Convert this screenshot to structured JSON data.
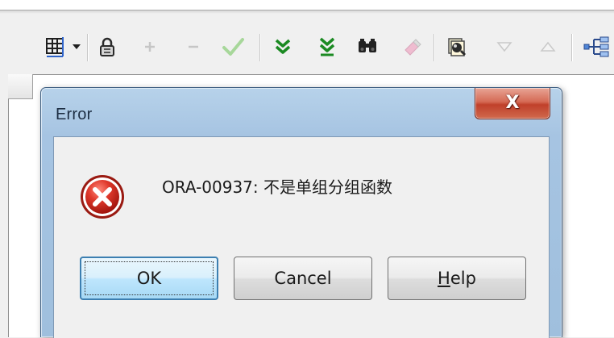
{
  "dialog": {
    "title": "Error",
    "close_glyph": "X",
    "message": "ORA-00937: 不是单组分组函数",
    "buttons": {
      "ok": "OK",
      "cancel": "Cancel",
      "help_underlined": "H",
      "help_rest": "elp"
    },
    "icon": "error-icon"
  },
  "toolbar": {
    "icons": [
      "table-grid-icon",
      "dropdown-arrow-icon",
      "lock-icon",
      "add-record-icon",
      "remove-record-icon",
      "post-checkmark-icon",
      "fetch-next-icon",
      "fetch-last-icon",
      "find-binoculars-icon",
      "clear-eraser-icon",
      "query-icon",
      "sort-descending-icon",
      "sort-ascending-icon",
      "explain-plan-icon"
    ]
  },
  "colors": {
    "dialog_frame": "#a6c4e2",
    "close_button": "#c0402a",
    "error_red": "#d5312a",
    "ok_focus": "#3c7fb1"
  }
}
